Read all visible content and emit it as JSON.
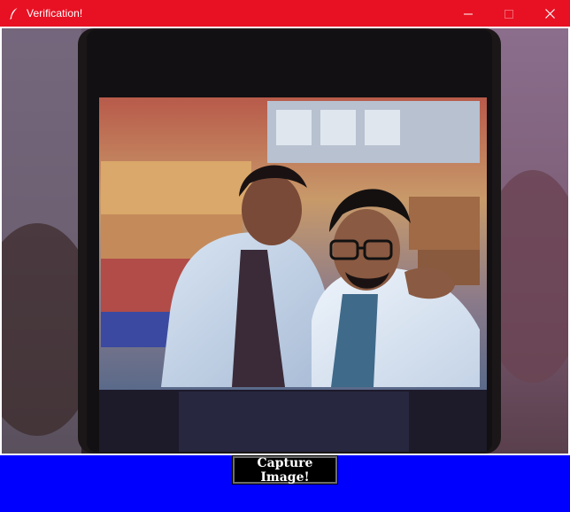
{
  "window": {
    "title": "Verification!",
    "icon": "feather-icon",
    "controls": [
      "minimize-icon",
      "maximize-icon",
      "close-icon"
    ],
    "titlebar_color": "#e81123"
  },
  "camera_feed": {
    "description_icon": "camera-preview"
  },
  "actions": {
    "capture_label": "Capture Image!"
  },
  "colors": {
    "background": "#0000ff",
    "button_bg": "#000000",
    "button_text": "#ffffff"
  }
}
